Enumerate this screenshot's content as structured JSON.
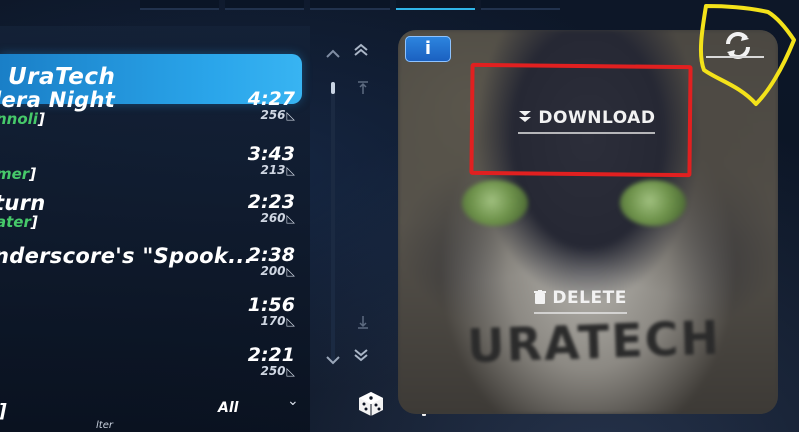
{
  "pack": {
    "title": "UraTech"
  },
  "songs": [
    {
      "title": "lera Night",
      "author": "nnoli",
      "duration": "4:27",
      "notes": "256"
    },
    {
      "title": "",
      "author": "mer",
      "duration": "3:43",
      "notes": "213"
    },
    {
      "title": "turn",
      "author": "ater",
      "duration": "2:23",
      "notes": "260"
    },
    {
      "title": "nderscore's \"Spook...",
      "author": "",
      "duration": "2:38",
      "notes": "200"
    },
    {
      "title": "",
      "author": "",
      "duration": "1:56",
      "notes": "170"
    },
    {
      "title": "",
      "author": "",
      "duration": "2:21",
      "notes": "250"
    }
  ],
  "filter": {
    "label": "]",
    "sub": "lter",
    "selected": "All"
  },
  "detail": {
    "info_label": "i",
    "download_label": "DOWNLOAD",
    "delete_label": "DELETE",
    "art_text": "URATECH"
  },
  "icons": {
    "scroll_up": "chevron-up-icon",
    "scroll_top": "double-chevron-up-icon",
    "scroll_down": "chevron-down-icon",
    "scroll_bottom": "double-chevron-down-icon",
    "random": "dice-icon",
    "settings": "gear-icon",
    "refresh": "refresh-icon",
    "download": "download-arrow-icon",
    "delete": "trash-icon"
  },
  "colors": {
    "accent": "#2aa5ea",
    "author_green": "#46c96a",
    "annotation_red": "#e12020",
    "annotation_yellow": "#f3e21a"
  }
}
